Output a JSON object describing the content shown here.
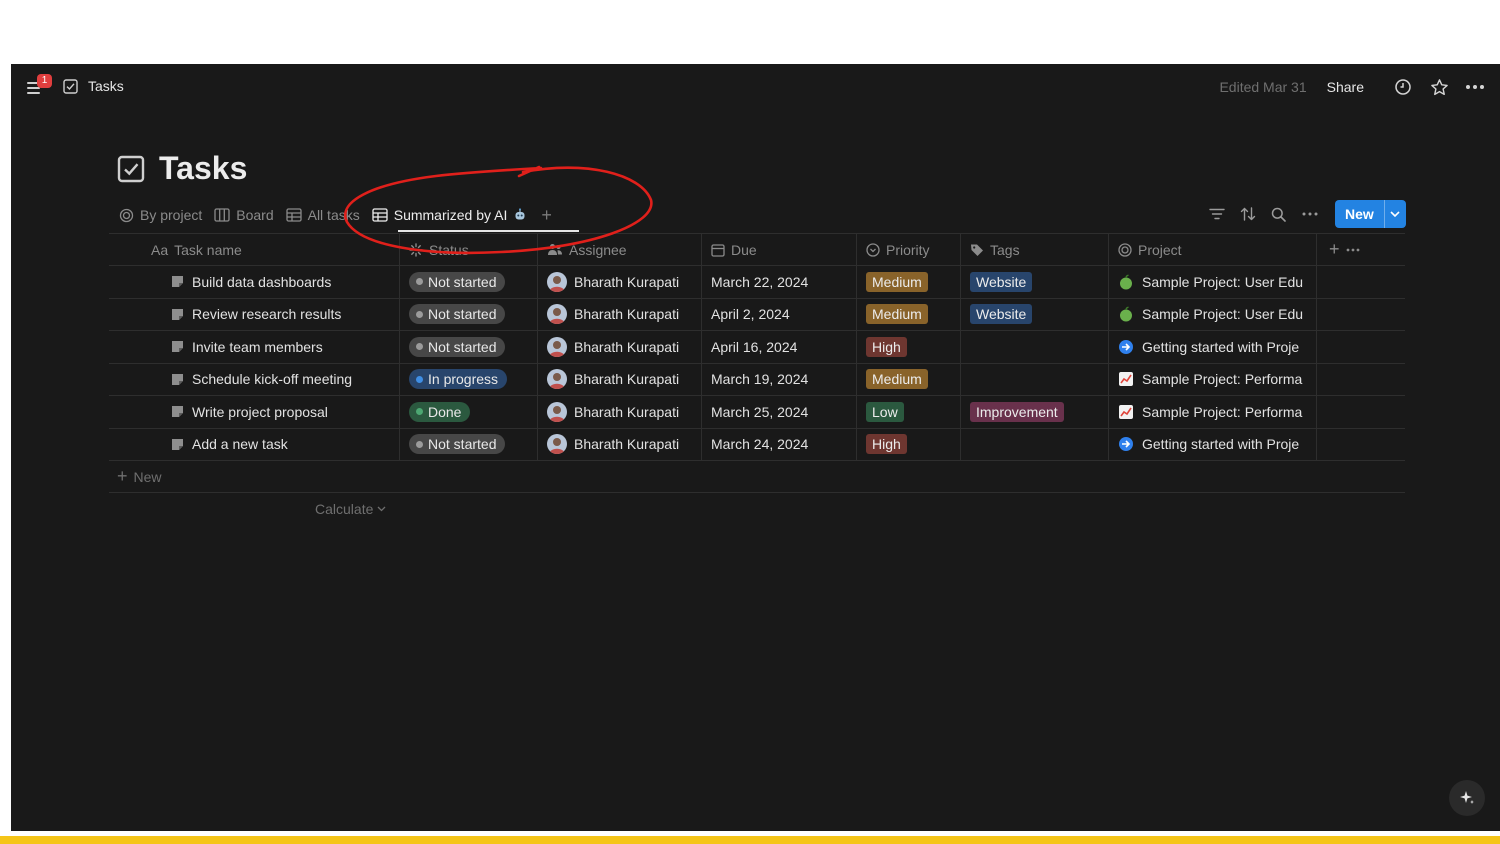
{
  "topbar": {
    "notification_count": "1",
    "breadcrumb": "Tasks",
    "edited": "Edited Mar 31",
    "share_label": "Share"
  },
  "page": {
    "title": "Tasks"
  },
  "views": [
    {
      "label": "By project",
      "icon": "target-icon"
    },
    {
      "label": "Board",
      "icon": "board-icon"
    },
    {
      "label": "All tasks",
      "icon": "table-icon"
    },
    {
      "label": "Summarized by AI",
      "icon": "table-icon",
      "active": true
    }
  ],
  "new_button": "New",
  "columns": {
    "name": "Task name",
    "name_prefix": "Aa",
    "status": "Status",
    "assignee": "Assignee",
    "due": "Due",
    "priority": "Priority",
    "tags": "Tags",
    "project": "Project"
  },
  "rows": [
    {
      "name": "Build data dashboards",
      "status": "Not started",
      "assignee": "Bharath Kurapati",
      "due": "March 22, 2024",
      "priority": "Medium",
      "tag": "Website",
      "project": "Sample Project: User Edu"
    },
    {
      "name": "Review research results",
      "status": "Not started",
      "assignee": "Bharath Kurapati",
      "due": "April 2, 2024",
      "priority": "Medium",
      "tag": "Website",
      "project": "Sample Project: User Edu"
    },
    {
      "name": "Invite team members",
      "status": "Not started",
      "assignee": "Bharath Kurapati",
      "due": "April 16, 2024",
      "priority": "High",
      "tag": "",
      "project": "Getting started with Proje"
    },
    {
      "name": "Schedule kick-off meeting",
      "status": "In progress",
      "assignee": "Bharath Kurapati",
      "due": "March 19, 2024",
      "priority": "Medium",
      "tag": "",
      "project": "Sample Project: Performa"
    },
    {
      "name": "Write project proposal",
      "status": "Done",
      "assignee": "Bharath Kurapati",
      "due": "March 25, 2024",
      "priority": "Low",
      "tag": "Improvement",
      "project": "Sample Project: Performa"
    },
    {
      "name": "Add a new task",
      "status": "Not started",
      "assignee": "Bharath Kurapati",
      "due": "March 24, 2024",
      "priority": "High",
      "tag": "",
      "project": "Getting started with Proje"
    }
  ],
  "new_row_label": "New",
  "calculate_label": "Calculate",
  "colors": {
    "background": "#191919",
    "accent": "#2383e2",
    "annotation": "#e0201b"
  }
}
